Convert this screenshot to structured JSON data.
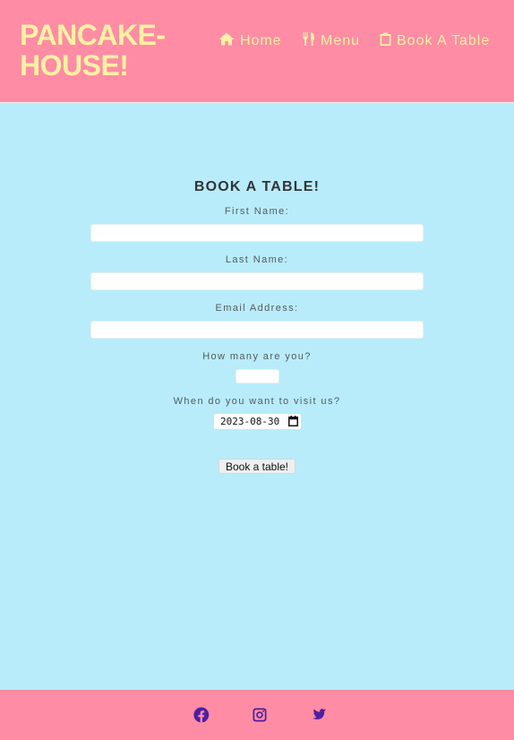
{
  "brand": {
    "logo_text": "PANCAKE-HOUSE!"
  },
  "nav": {
    "items": [
      {
        "label": "Home",
        "icon": "home-icon"
      },
      {
        "label": "Menu",
        "icon": "utensils-icon"
      },
      {
        "label": "Book A Table",
        "icon": "clipboard-icon"
      }
    ]
  },
  "booking": {
    "heading": "BOOK A TABLE!",
    "first_name_label": "First Name:",
    "last_name_label": "Last Name:",
    "email_label": "Email Address:",
    "party_size_label": "How many are you?",
    "date_label": "When do you want to visit us?",
    "date_value": "2023-08-30",
    "submit_label": "Book a table!"
  },
  "footer": {
    "social": [
      "facebook-icon",
      "instagram-icon",
      "twitter-icon"
    ]
  },
  "colors": {
    "header_bg": "#ff8ca5",
    "page_bg": "#b8ecfa",
    "brand_text": "#fff1a3",
    "social_icons": "#4e1fa0"
  }
}
